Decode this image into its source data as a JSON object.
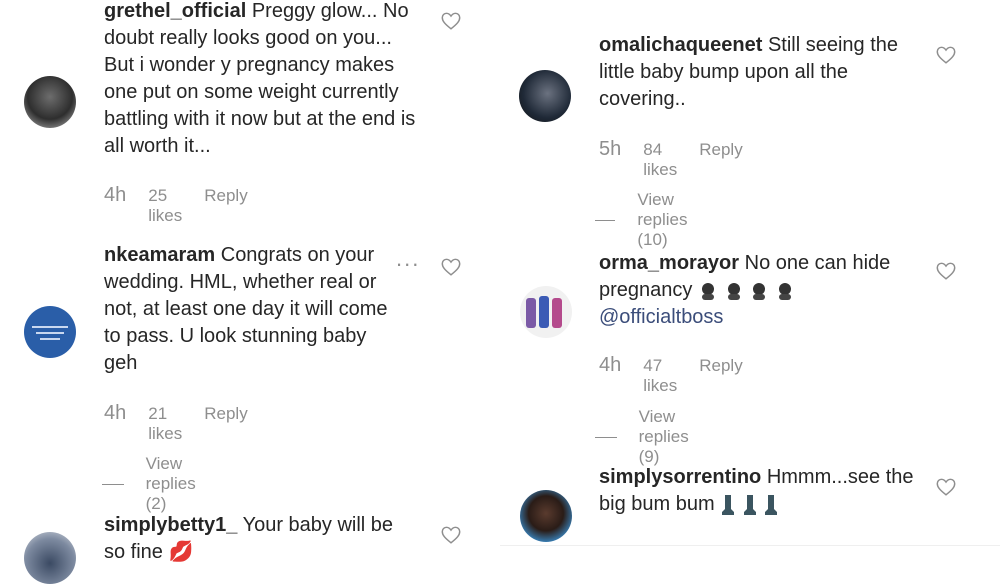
{
  "left": {
    "c1": {
      "user": "grethel_official",
      "text": " Preggy glow... No doubt really looks good on you... But i wonder y pregnancy makes one put on some weight currently battling with it now but at the end is all worth it...",
      "time": "4h",
      "likes": "25 likes",
      "reply": "Reply"
    },
    "c2": {
      "user": "nkeamaram",
      "text": " Congrats on your wedding. HML, whether real or not, at least one day it will come to pass. U look stunning baby geh",
      "time": "4h",
      "likes": "21 likes",
      "reply": "Reply",
      "view_replies": "View replies (2)",
      "more": "..."
    },
    "c3": {
      "user": "simplybetty1_",
      "text": " Your baby will be so fine 💋"
    }
  },
  "right": {
    "c1": {
      "user": "omalichaqueenet",
      "text": " Still seeing the little baby bump upon all the covering..",
      "time": "5h",
      "likes": "84 likes",
      "reply": "Reply",
      "view_replies": "View replies (10)"
    },
    "c2": {
      "user": "orma_morayor",
      "text": " No one can hide pregnancy ",
      "mention": "@officialtboss",
      "time": "4h",
      "likes": "47 likes",
      "reply": "Reply",
      "view_replies": "View replies (9)"
    },
    "c3": {
      "user": "simplysorrentino",
      "text": " Hmmm...see the big bum bum"
    }
  },
  "icons": {
    "heart": "heart-outline-icon",
    "emoji_face": "face-emoji",
    "emoji_boot": "boot-emoji"
  },
  "colors": {
    "text": "#262626",
    "muted": "#8e8e8e",
    "mention": "#3b4d7a"
  }
}
